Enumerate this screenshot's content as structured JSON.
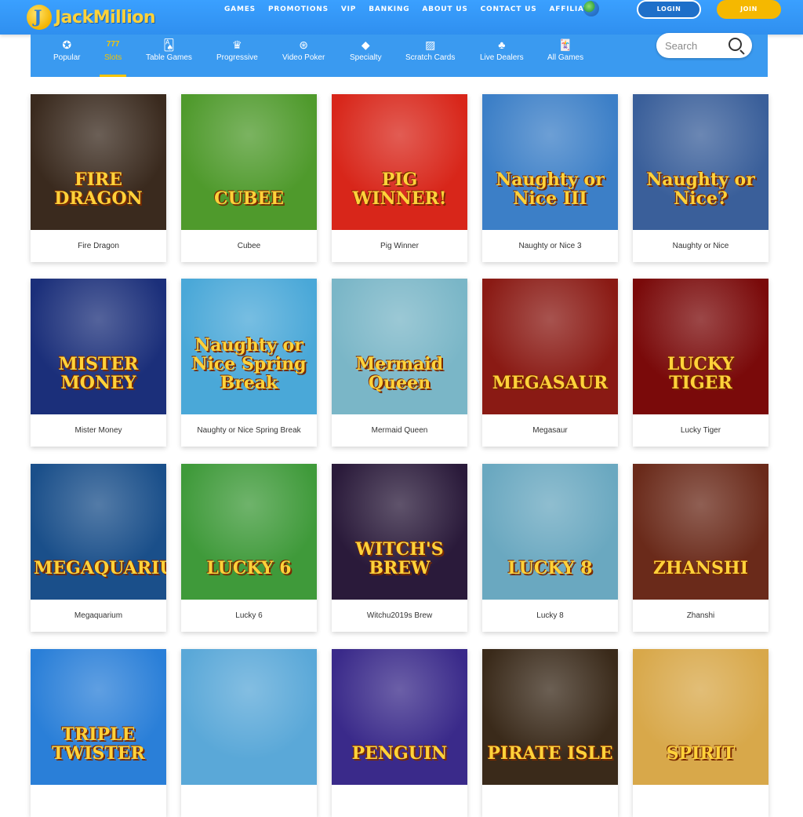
{
  "brand": {
    "name": "JackMillion"
  },
  "nav": {
    "items": [
      "GAMES",
      "PROMOTIONS",
      "VIP",
      "BANKING",
      "ABOUT US",
      "CONTACT US",
      "AFFILIATE"
    ],
    "login_label": "LOGIN",
    "join_label": "JOIN"
  },
  "categories": [
    {
      "label": "Popular",
      "icon": "star-icon"
    },
    {
      "label": "Slots",
      "icon": "slots-777-icon",
      "glyph": "777",
      "active": true
    },
    {
      "label": "Table Games",
      "icon": "cards-icon"
    },
    {
      "label": "Progressive",
      "icon": "crown-icon"
    },
    {
      "label": "Video Poker",
      "icon": "chip-icon"
    },
    {
      "label": "Specialty",
      "icon": "diamond-icon"
    },
    {
      "label": "Scratch Cards",
      "icon": "scratch-card-icon"
    },
    {
      "label": "Live Dealers",
      "icon": "dealer-icon"
    },
    {
      "label": "All Games",
      "icon": "all-cards-icon"
    }
  ],
  "search": {
    "placeholder": "Search"
  },
  "games": [
    {
      "name": "Fire Dragon",
      "art_text": "FIRE DRAGON",
      "bg": "#3a2a1e"
    },
    {
      "name": "Cubee",
      "art_text": "CUBEE",
      "bg": "#4f9a2c"
    },
    {
      "name": "Pig Winner",
      "art_text": "PIG WINNER!",
      "bg": "#d8261a"
    },
    {
      "name": "Naughty or Nice 3",
      "art_text": "Naughty or Nice III",
      "bg": "#3c7fc7"
    },
    {
      "name": "Naughty or Nice",
      "art_text": "Naughty or Nice?",
      "bg": "#3a5f9a"
    },
    {
      "name": "Mister Money",
      "art_text": "MISTER MONEY",
      "bg": "#1b2f7a"
    },
    {
      "name": "Naughty or Nice Spring Break",
      "art_text": "Naughty or Nice Spring Break",
      "bg": "#4aa8d8"
    },
    {
      "name": "Mermaid Queen",
      "art_text": "Mermaid Queen",
      "bg": "#7ab6c7"
    },
    {
      "name": "Megasaur",
      "art_text": "MEGASAUR",
      "bg": "#8a1a14"
    },
    {
      "name": "Lucky Tiger",
      "art_text": "LUCKY TIGER",
      "bg": "#7a0a0a"
    },
    {
      "name": "Megaquarium",
      "art_text": "MEGAQUARIUM",
      "bg": "#1a4f8a"
    },
    {
      "name": "Lucky 6",
      "art_text": "LUCKY 6",
      "bg": "#3f9a3a"
    },
    {
      "name": "Witchu2019s Brew",
      "art_text": "WITCH'S BREW",
      "bg": "#2a1a3a"
    },
    {
      "name": "Lucky 8",
      "art_text": "LUCKY 8",
      "bg": "#6aa8c0"
    },
    {
      "name": "Zhanshi",
      "art_text": "ZHANSHI",
      "bg": "#6a2a1a"
    },
    {
      "name": "",
      "art_text": "TRIPLE TWISTER",
      "bg": "#2a7fd8"
    },
    {
      "name": "",
      "art_text": "",
      "bg": "#5aa8d8"
    },
    {
      "name": "",
      "art_text": "PENGUIN",
      "bg": "#3a2a8a"
    },
    {
      "name": "",
      "art_text": "PIRATE ISLE",
      "bg": "#3a2a1a"
    },
    {
      "name": "",
      "art_text": "SPIRIT",
      "bg": "#d8a84a"
    }
  ]
}
